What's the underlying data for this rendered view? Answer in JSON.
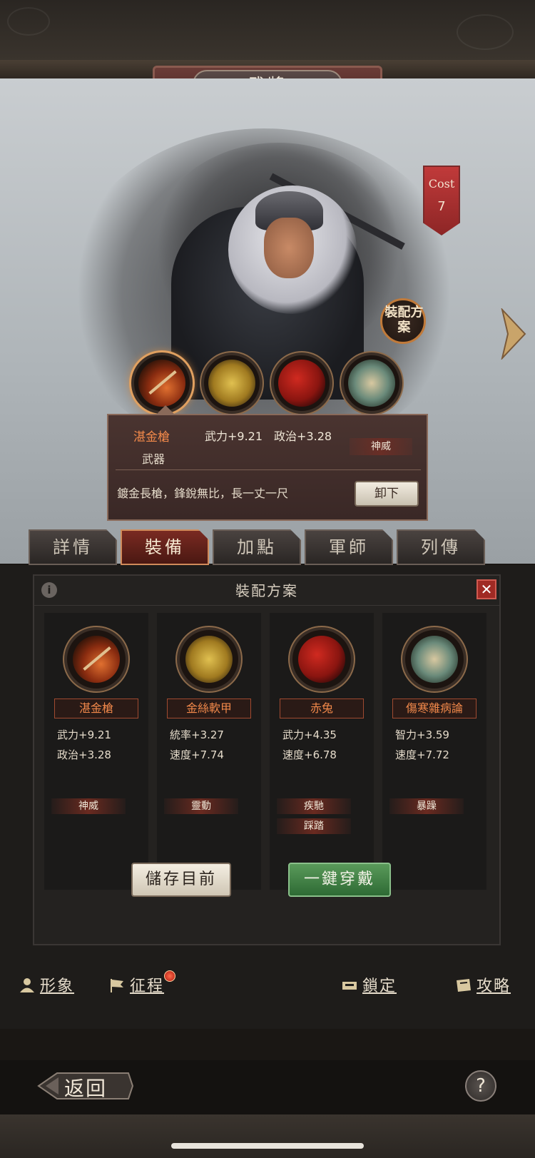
{
  "header": {
    "title": "武將"
  },
  "hero": {
    "cost_label": "Cost",
    "cost_value": "7",
    "scheme_button_label": "裝配方案"
  },
  "equip_slots": [
    {
      "name": "湛金槍",
      "icon": "spear-icon",
      "selected": true
    },
    {
      "name": "金絲軟甲",
      "icon": "armor-icon"
    },
    {
      "name": "赤兔",
      "icon": "horse-icon"
    },
    {
      "name": "傷寒雜病論",
      "icon": "book-icon"
    }
  ],
  "info_card": {
    "name": "湛金槍",
    "type": "武器",
    "stats": "武力+9.21　政治+3.28",
    "skill": "神威",
    "description": "鍍金長槍，鋒銳無比，長一丈一尺",
    "unequip_label": "卸下"
  },
  "tabs": [
    {
      "label": "詳情"
    },
    {
      "label": "裝備",
      "active": true
    },
    {
      "label": "加點"
    },
    {
      "label": "軍師"
    },
    {
      "label": "列傳"
    }
  ],
  "panel": {
    "info_icon": "i",
    "title": "裝配方案",
    "close": "✕",
    "columns": [
      {
        "name": "湛金槍",
        "stats": [
          "武力+9.21",
          "政治+3.28"
        ],
        "skills": [
          "神威"
        ]
      },
      {
        "name": "金絲軟甲",
        "stats": [
          "統率+3.27",
          "速度+7.74"
        ],
        "skills": [
          "靈動"
        ]
      },
      {
        "name": "赤兔",
        "stats": [
          "武力+4.35",
          "速度+6.78"
        ],
        "skills": [
          "疾馳",
          "踩踏"
        ]
      },
      {
        "name": "傷寒雜病論",
        "stats": [
          "智力+3.59",
          "速度+7.72"
        ],
        "skills": [
          "暴躁"
        ]
      }
    ],
    "save_label": "儲存目前",
    "onekey_label": "一鍵穿戴"
  },
  "bottom_links": [
    {
      "label": "形象",
      "icon": "person-icon"
    },
    {
      "label": "征程",
      "icon": "flag-icon",
      "badge": true
    },
    {
      "label": "鎖定",
      "icon": "lock-icon"
    },
    {
      "label": "攻略",
      "icon": "scroll-icon"
    }
  ],
  "footer": {
    "back_label": "返回",
    "help_label": "?"
  },
  "colors": {
    "accent_orange": "#f0884a",
    "tab_active": "#7a2a22",
    "confirm_green": "#2e6a34"
  }
}
